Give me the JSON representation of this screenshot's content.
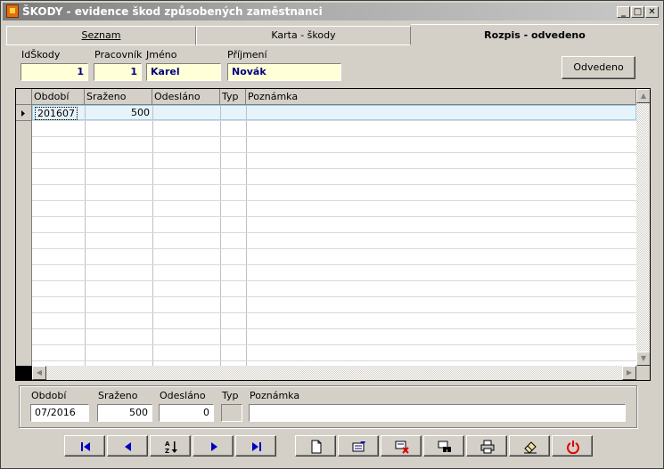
{
  "window": {
    "title": "ŠKODY - evidence škod způsobených zaměstnanci"
  },
  "tabs": [
    {
      "label": "Seznam",
      "active": false
    },
    {
      "label": "Karta - škody",
      "active": false
    },
    {
      "label": "Rozpis - odvedeno",
      "active": true
    }
  ],
  "header": {
    "idskody_label": "IdŠkody",
    "idskody_value": "1",
    "pracovnik_label": "Pracovník",
    "pracovnik_value": "1",
    "jmeno_label": "Jméno",
    "jmeno_value": "Karel",
    "prijmeni_label": "Příjmení",
    "prijmeni_value": "Novák",
    "odvedeno_button": "Odvedeno"
  },
  "grid": {
    "columns": [
      "Období",
      "Sraženo",
      "Odesláno",
      "Typ",
      "Poznámka"
    ],
    "rows": [
      {
        "obdobi": "201607",
        "srazeno": "500",
        "odeslano": "",
        "typ": "",
        "poznamka": ""
      }
    ]
  },
  "detail": {
    "obdobi_label": "Období",
    "obdobi_value": "07/2016",
    "srazeno_label": "Sraženo",
    "srazeno_value": "500",
    "odeslano_label": "Odesláno",
    "odeslano_value": "0",
    "typ_label": "Typ",
    "typ_value": "",
    "poznamka_label": "Poznámka",
    "poznamka_value": ""
  },
  "toolbar": {
    "nav_icons": [
      "first-record-icon",
      "previous-record-icon",
      "sort-az-icon",
      "next-record-icon",
      "last-record-icon"
    ],
    "action_icons": [
      "new-record-icon",
      "edit-record-icon",
      "delete-record-icon",
      "find-icon",
      "print-icon",
      "erase-icon",
      "power-off-icon"
    ]
  },
  "colors": {
    "field_yellow": "#ffffd8",
    "field_text": "#000080",
    "selected_row": "#e6f3fb",
    "nav_blue": "#0000c0",
    "power_red": "#e00000"
  }
}
